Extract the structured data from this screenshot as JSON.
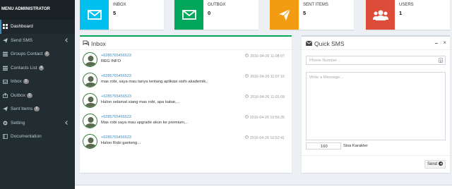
{
  "sidebar": {
    "header": "MENU ADMINISTRATOR",
    "items": [
      {
        "label": "Dashboard",
        "icon": "dashboard-icon"
      },
      {
        "label": "Send SMS",
        "icon": "send-icon"
      },
      {
        "label": "Groups Contact",
        "badge": "2",
        "icon": "list-icon"
      },
      {
        "label": "Contacts List",
        "badge": "4",
        "icon": "list-icon"
      },
      {
        "label": "Inbox",
        "badge": "5",
        "icon": "inbox-icon"
      },
      {
        "label": "Outbox",
        "badge": "0",
        "icon": "outbox-icon"
      },
      {
        "label": "Sent Items",
        "badge": "5",
        "icon": "sent-icon"
      },
      {
        "label": "Setting",
        "icon": "gear-icon"
      },
      {
        "label": "Documentation",
        "icon": "book-icon"
      }
    ]
  },
  "stats": [
    {
      "label": "INBOX",
      "count": "5",
      "color": "#00c0ef",
      "icon": "envelope-icon"
    },
    {
      "label": "OUTBOX",
      "count": "0",
      "color": "#00a65a",
      "icon": "envelope-icon"
    },
    {
      "label": "SENT ITEMS",
      "count": "5",
      "color": "#f39c12",
      "icon": "paper-plane-icon"
    },
    {
      "label": "USERS",
      "count": "1",
      "color": "#dd4b39",
      "icon": "users-icon"
    }
  ],
  "inbox": {
    "title": "Inbox",
    "messages": [
      {
        "from": "+6285765456523",
        "time": "2016-04-26 11:08:07",
        "body": "REG INFO"
      },
      {
        "from": "+6285765456523",
        "time": "2016-04-26 11:07:16",
        "body": "mas robi, saya mau tanya tentang aplikasi sisfo akademik.."
      },
      {
        "from": "+6285765456523",
        "time": "2016-04-26 11:01:09",
        "body": "Haloo selamat siang mas robi, apa kabar,..."
      },
      {
        "from": "+6285765456523",
        "time": "2016-04-26 10:56:26",
        "body": "Mas robi saya mau upgrade akun ke premium,.."
      },
      {
        "from": "+6285765456523",
        "time": "2016-04-26 10:52:41",
        "body": "Haloo Robi ganteng..."
      }
    ]
  },
  "quick_sms": {
    "title": "Quick SMS",
    "phone_placeholder": "Phone Number...",
    "message_placeholder": "Write a Message...",
    "char_count": "160",
    "char_label": "Sisa Karakter",
    "send_label": "Send"
  }
}
